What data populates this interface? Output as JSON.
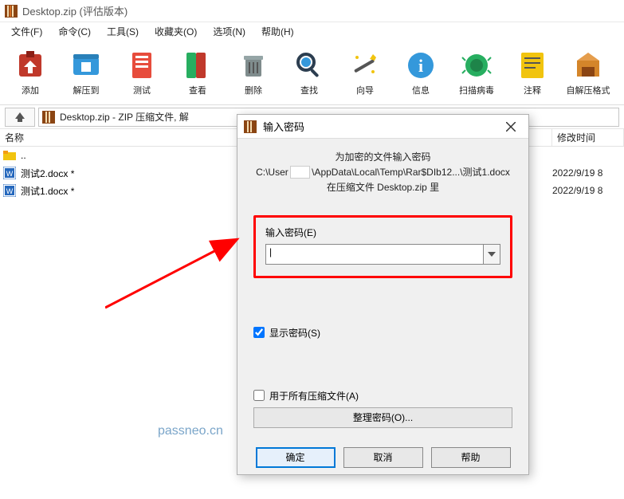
{
  "window": {
    "title": "Desktop.zip (评估版本)"
  },
  "menu": {
    "file": "文件(F)",
    "command": "命令(C)",
    "tool": "工具(S)",
    "fav": "收藏夹(O)",
    "option": "选项(N)",
    "help": "帮助(H)"
  },
  "toolbar": {
    "add": "添加",
    "extract": "解压到",
    "test": "测试",
    "view": "查看",
    "delete": "删除",
    "find": "查找",
    "wizard": "向导",
    "info": "信息",
    "scan": "扫描病毒",
    "comment": "注释",
    "sfx": "自解压格式"
  },
  "address": {
    "text": "Desktop.zip - ZIP 压缩文件, 解"
  },
  "columns": {
    "name": "名称",
    "time": "修改时间"
  },
  "files": {
    "up": "..",
    "f2": "测试2.docx *",
    "f1": "测试1.docx *",
    "t2": "2022/9/19 8",
    "t1": "2022/9/19 8"
  },
  "dialog": {
    "title": "输入密码",
    "msg1": "为加密的文件输入密码",
    "msg2a": "C:\\User",
    "msg2b": "\\AppData\\Local\\Temp\\Rar$DIb12...\\测试1.docx",
    "msg3": "在压缩文件 Desktop.zip 里",
    "pwlabel": "输入密码(E)",
    "cursor": "|",
    "showpw": "显示密码(S)",
    "allarch": "用于所有压缩文件(A)",
    "org": "整理密码(O)...",
    "ok": "确定",
    "cancel": "取消",
    "helpbtn": "帮助"
  },
  "watermark": "passneo.cn"
}
